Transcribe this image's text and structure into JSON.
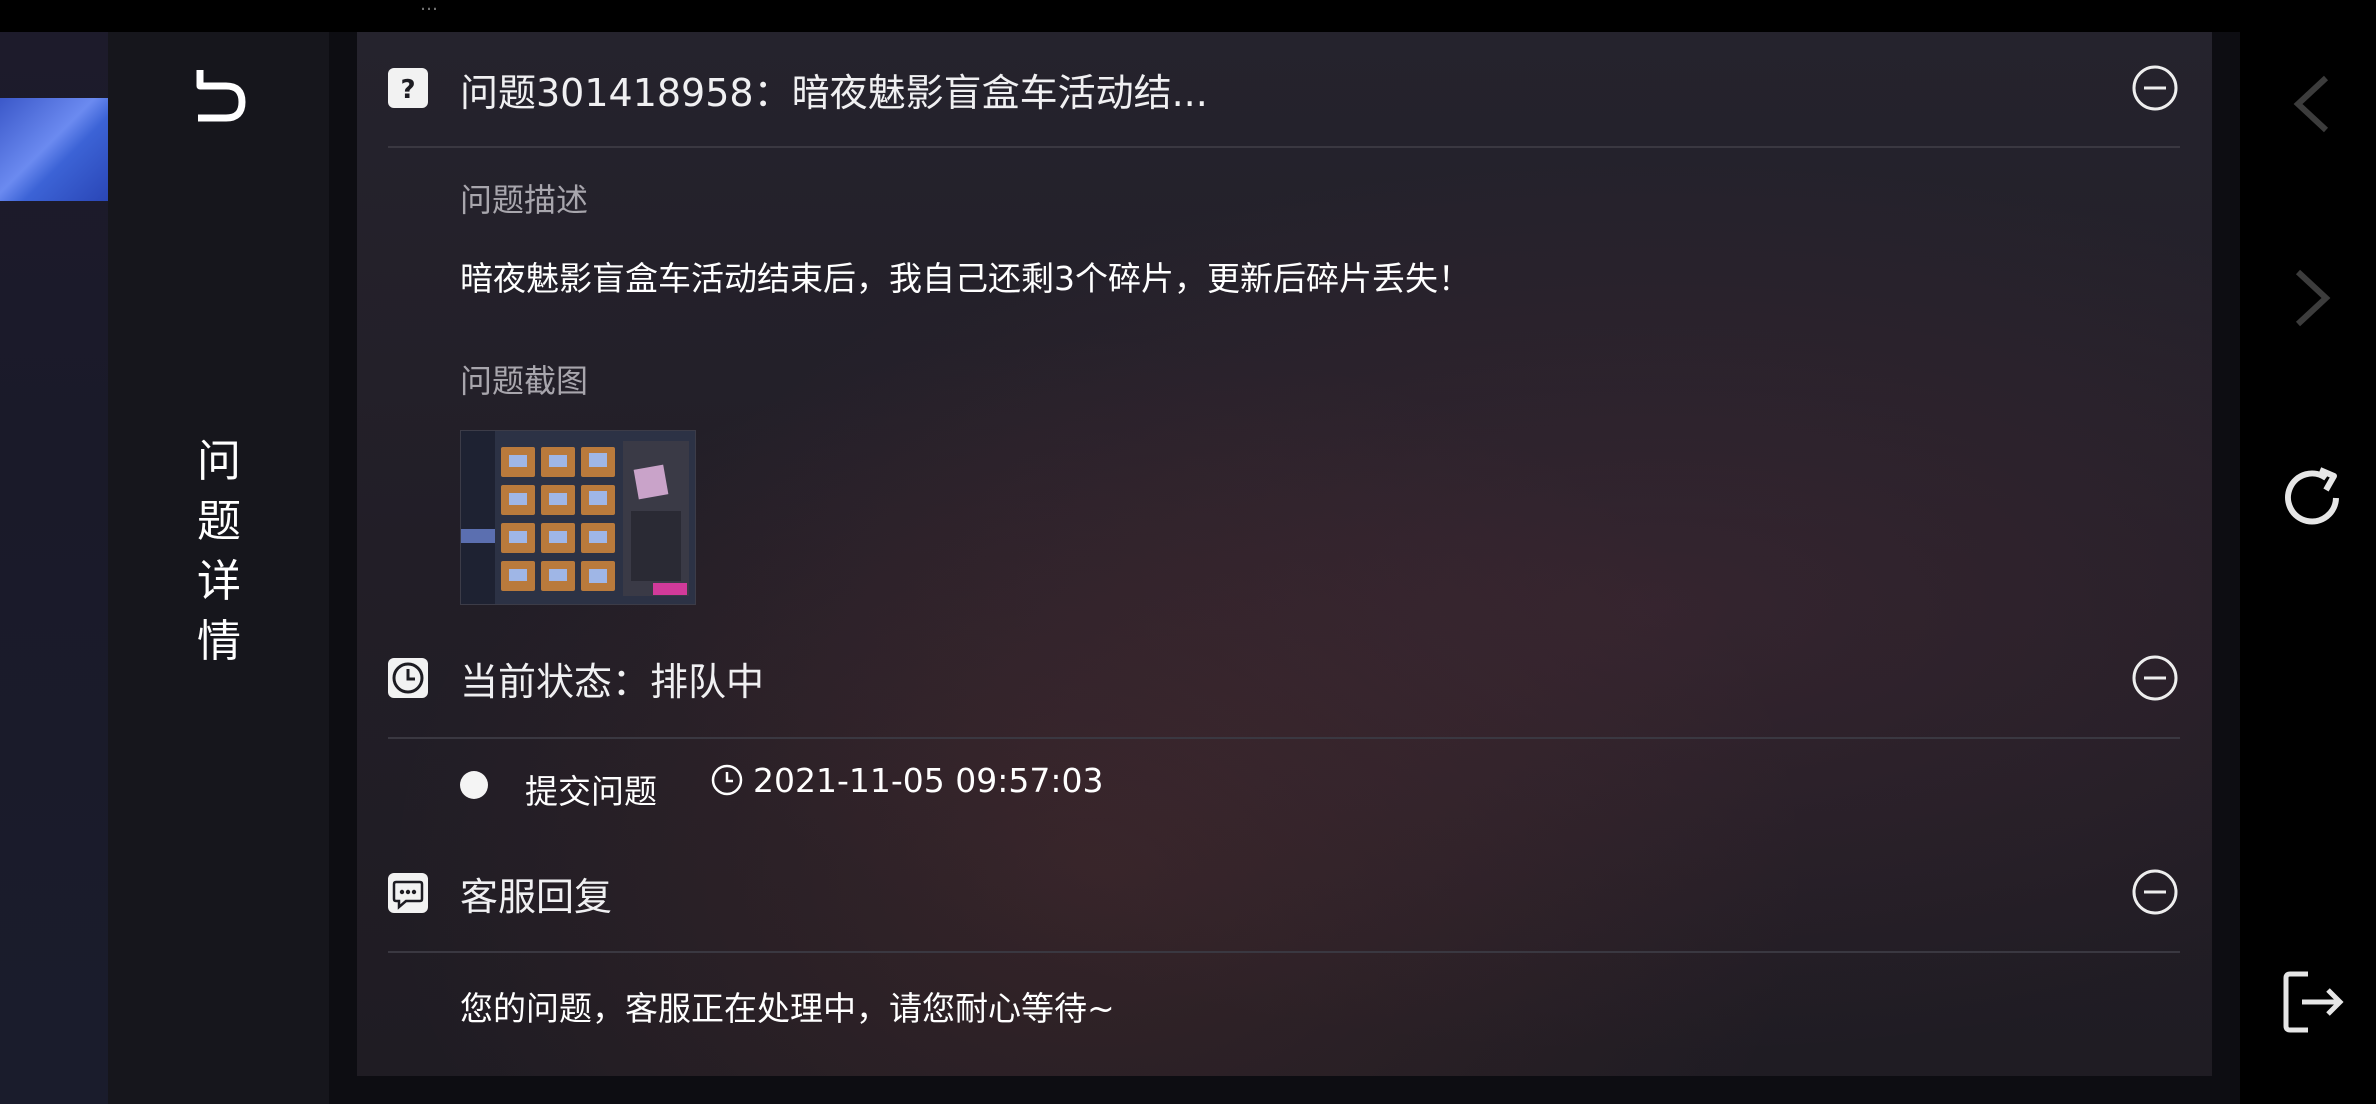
{
  "status_bar": {
    "fragment": "…"
  },
  "sidebar": {
    "title_chars": [
      "问",
      "题",
      "详",
      "情"
    ]
  },
  "question": {
    "title": "问题301418958：暗夜魅影盲盒车活动结...",
    "description_label": "问题描述",
    "description": "暗夜魅影盲盒车活动结束后，我自己还剩3个碎片，更新后碎片丢失！",
    "screenshot_label": "问题截图"
  },
  "status": {
    "title": "当前状态：排队中",
    "event_label": "提交问题",
    "timestamp": "2021-11-05 09:57:03"
  },
  "reply": {
    "title": "客服回复",
    "message": "您的问题，客服正在处理中，请您耐心等待~"
  },
  "colors": {
    "background": "#0d0d12",
    "panel": "#221e27",
    "title_column": "#16161c",
    "text": "#ffffff",
    "muted_text": "#a8a6ad",
    "divider": "#3a3841"
  },
  "icons": {
    "back": "back-arrow-icon",
    "question": "question-mark-icon",
    "status": "clock-icon",
    "reply": "chat-bubble-icon",
    "collapse": "minus-circle-icon",
    "nav_prev": "chevron-left-icon",
    "nav_next": "chevron-right-icon",
    "refresh": "refresh-icon",
    "exit": "exit-icon"
  }
}
